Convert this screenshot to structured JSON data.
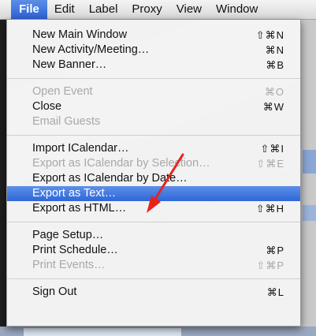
{
  "menubar": {
    "items": [
      {
        "label": ""
      },
      {
        "label": "File",
        "active": true
      },
      {
        "label": "Edit"
      },
      {
        "label": "Label"
      },
      {
        "label": "Proxy"
      },
      {
        "label": "View"
      },
      {
        "label": "Window"
      }
    ]
  },
  "file_menu": {
    "groups": [
      [
        {
          "label": "New Main Window",
          "shortcut": "⇧⌘N",
          "enabled": true
        },
        {
          "label": "New Activity/Meeting…",
          "shortcut": "⌘N",
          "enabled": true
        },
        {
          "label": "New Banner…",
          "shortcut": "⌘B",
          "enabled": true
        }
      ],
      [
        {
          "label": "Open Event",
          "shortcut": "⌘O",
          "enabled": false
        },
        {
          "label": "Close",
          "shortcut": "⌘W",
          "enabled": true
        },
        {
          "label": "Email Guests",
          "shortcut": "",
          "enabled": false
        }
      ],
      [
        {
          "label": "Import ICalendar…",
          "shortcut": "⇧⌘I",
          "enabled": true
        },
        {
          "label": "Export as ICalendar by Selection…",
          "shortcut": "⇧⌘E",
          "enabled": false
        },
        {
          "label": "Export as ICalendar by Date…",
          "shortcut": "",
          "enabled": true
        },
        {
          "label": "Export as Text…",
          "shortcut": "",
          "enabled": true,
          "highlighted": true
        },
        {
          "label": "Export as HTML…",
          "shortcut": "⇧⌘H",
          "enabled": true
        }
      ],
      [
        {
          "label": "Page Setup…",
          "shortcut": "",
          "enabled": true
        },
        {
          "label": "Print Schedule…",
          "shortcut": "⌘P",
          "enabled": true
        },
        {
          "label": "Print Events…",
          "shortcut": "⇧⌘P",
          "enabled": false
        }
      ],
      [
        {
          "label": "Sign Out",
          "shortcut": "⌘L",
          "enabled": true
        }
      ]
    ]
  },
  "annotation": {
    "color": "#e8231b",
    "icon": "arrow-icon"
  }
}
